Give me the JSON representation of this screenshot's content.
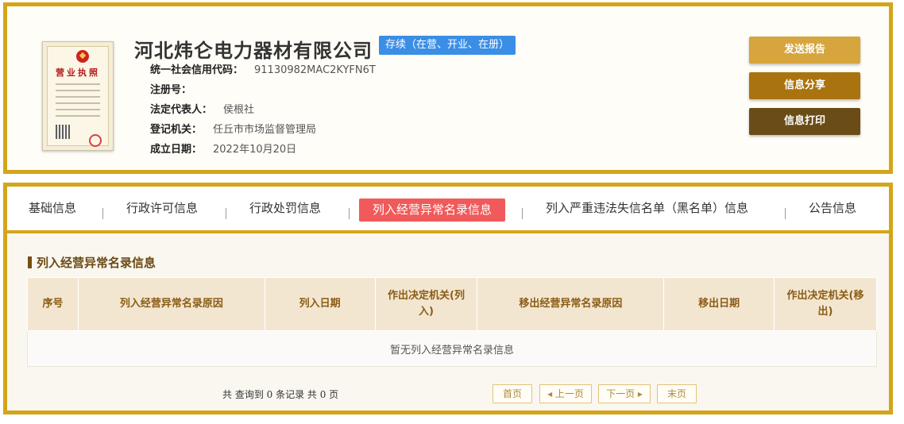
{
  "company": {
    "name": "河北炜仑电力器材有限公司",
    "status": "存续（在营、开业、在册）",
    "license_title": "营业执照",
    "fields": [
      {
        "label": "统一社会信用代码：",
        "value": "91130982MAC2KYFN6T"
      },
      {
        "label": "注册号：",
        "value": ""
      },
      {
        "label": "法定代表人：",
        "value": "侯根社"
      },
      {
        "label": "登记机关：",
        "value": "任丘市市场监督管理局"
      },
      {
        "label": "成立日期：",
        "value": "2022年10月20日"
      }
    ]
  },
  "actions": {
    "report": "发送报告",
    "share": "信息分享",
    "print": "信息打印"
  },
  "tabs": [
    "基础信息",
    "行政许可信息",
    "行政处罚信息",
    "列入经营异常名录信息",
    "列入严重违法失信名单（黑名单）信息",
    "公告信息"
  ],
  "active_tab_index": 3,
  "section": {
    "title": "列入经营异常名录信息",
    "columns": [
      "序号",
      "列入经营异常名录原因",
      "列入日期",
      "作出决定机关(列入)",
      "移出经营异常名录原因",
      "移出日期",
      "作出决定机关(移出)"
    ],
    "empty_text": "暂无列入经营异常名录信息"
  },
  "pagination": {
    "summary": "共 查询到 0 条记录 共 0 页",
    "first": "首页",
    "prev": "上一页",
    "next": "下一页",
    "last": "末页"
  },
  "colors": {
    "frame": "#d4a517",
    "status_badge": "#3a8ee6",
    "active_tab": "#f05a5a",
    "btn_report": "#d6a53d",
    "btn_share": "#a9730f",
    "btn_print": "#6a4c17"
  }
}
